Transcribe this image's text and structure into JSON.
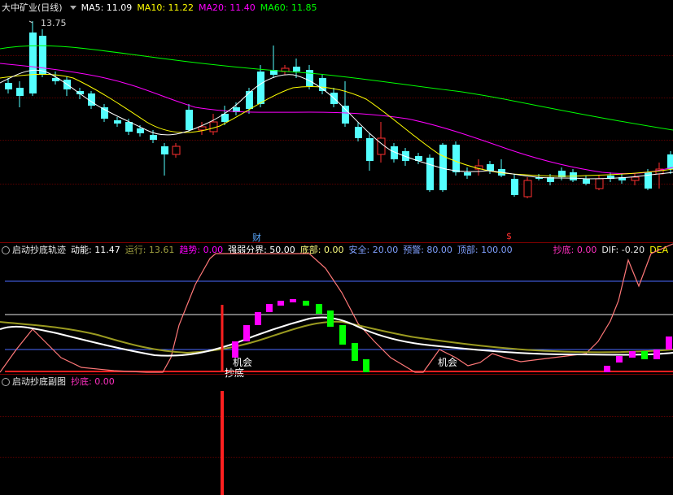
{
  "main": {
    "title": "大中矿业(日线)",
    "ma5": "MA5: 11.09",
    "ma10": "MA10: 11.22",
    "ma20": "MA20: 11.40",
    "ma60": "MA60: 11.85",
    "high_label": "13.75",
    "marker_cai": "财",
    "marker_dollar": "$"
  },
  "ind1": {
    "name": "启动抄底轨迹",
    "dongneng": "动能: 11.47",
    "yunxing": "运行: 13.61",
    "qushi": "趋势: 0.00",
    "qiangruo": "强弱分界: 50.00",
    "dibu": "底部: 0.00",
    "anquan": "安全: 20.00",
    "yujing": "预警: 80.00",
    "dingbu": "顶部: 100.00",
    "chaodi": "抄底: 0.00",
    "dif": "DIF: -0.20",
    "dea": "DEA",
    "label_jihui1": "机会",
    "label_chaodi": "抄底",
    "label_jihui2": "机会"
  },
  "ind2": {
    "name": "启动抄底副图",
    "chaodi": "抄底: 0.00"
  },
  "colors": {
    "up": "#ff3030",
    "down": "#54ffff",
    "ma5": "#ffffff",
    "ma10": "#ffff00",
    "ma20": "#ff00ff",
    "ma60": "#00ff00",
    "magenta": "#ff00ff",
    "green": "#00ff00",
    "salmon": "#ff7878"
  }
}
